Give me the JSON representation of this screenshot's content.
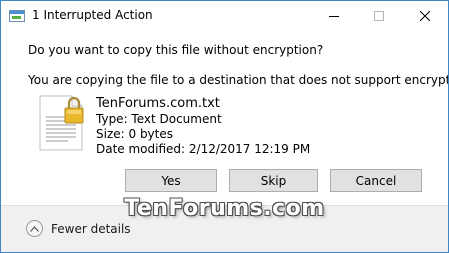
{
  "window": {
    "title": "1 Interrupted Action"
  },
  "dialog": {
    "question": "Do you want to copy this file without encryption?",
    "explanation": "You are copying the file to a destination that does not support encryption."
  },
  "file": {
    "name": "TenForums.com.txt",
    "type": "Type: Text Document",
    "size": "Size: 0 bytes",
    "modified": "Date modified: 2/12/2017 12:19 PM",
    "icon": "encrypted-text-file-icon"
  },
  "buttons": {
    "yes": "Yes",
    "skip": "Skip",
    "cancel": "Cancel"
  },
  "footer": {
    "fewer_details": "Fewer details"
  },
  "watermark": "TenForums.com",
  "colors": {
    "window_border": "#3e86c4",
    "button_face": "#e1e1e1",
    "button_border": "#adadad",
    "footer_bg": "#f0f0f0",
    "lock_gold": "#e8b72c"
  }
}
